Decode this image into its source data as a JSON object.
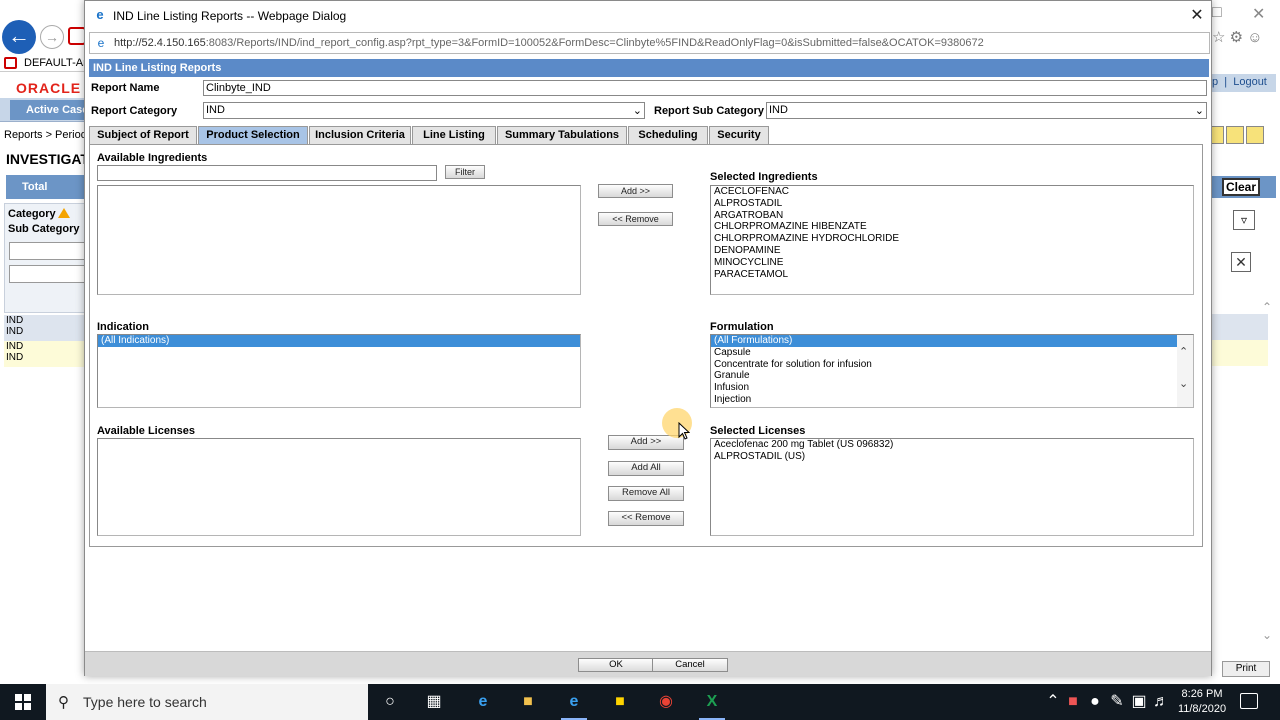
{
  "browser": {
    "tab_title": "DEFAULT-Ar",
    "oracle_logo": "ORACLE",
    "active_case_tab": "Active Case",
    "breadcrumb": "Reports > Period",
    "page_heading": "INVESTIGAT",
    "total_label": "Total Numbe",
    "category_label": "Category",
    "subcategory_label": "Sub Category",
    "rows": [
      "IND",
      "IND",
      "IND",
      "IND"
    ],
    "help_link": "p",
    "logout_link": "Logout",
    "clear_button": "Clear",
    "print_button": "Print"
  },
  "dialog": {
    "title": "IND Line Listing Reports -- Webpage Dialog",
    "url_host": "http://52.4.150.165",
    "url_rest": ":8083/Reports/IND/ind_report_config.asp?rpt_type=3&FormID=100052&FormDesc=Clinbyte%5FIND&ReadOnlyFlag=0&isSubmitted=false&OCATOK=9380672",
    "header": "IND Line Listing Reports",
    "report_name_label": "Report Name",
    "report_name_value": "Clinbyte_IND",
    "report_category_label": "Report Category",
    "report_category_value": "IND",
    "report_subcategory_label": "Report Sub Category",
    "report_subcategory_value": "IND",
    "tabs": [
      "Subject of Report",
      "Product Selection",
      "Inclusion Criteria",
      "Line Listing",
      "Summary Tabulations",
      "Scheduling",
      "Security"
    ],
    "active_tab": "Product Selection",
    "available_ingredients_label": "Available Ingredients",
    "filter_button": "Filter",
    "ingredients_add_button": "Add >>",
    "ingredients_remove_button": "<< Remove",
    "selected_ingredients_label": "Selected Ingredients",
    "selected_ingredients": [
      "ACECLOFENAC",
      "ALPROSTADIL",
      "ARGATROBAN",
      "CHLORPROMAZINE HIBENZATE",
      "CHLORPROMAZINE HYDROCHLORIDE",
      "DENOPAMINE",
      "MINOCYCLINE",
      "PARACETAMOL"
    ],
    "indication_label": "Indication",
    "indications": [
      "(All Indications)"
    ],
    "formulation_label": "Formulation",
    "formulations": [
      "(All Formulations)",
      "Capsule",
      "Concentrate for solution for infusion",
      "Granule",
      "Infusion",
      "Injection"
    ],
    "available_licenses_label": "Available Licenses",
    "licenses_add_button": "Add >>",
    "licenses_add_all_button": "Add All",
    "licenses_remove_all_button": "Remove All",
    "licenses_remove_button": "<< Remove",
    "selected_licenses_label": "Selected Licenses",
    "selected_licenses": [
      "Aceclofenac 200 mg Tablet (US 096832)",
      "ALPROSTADIL (US)"
    ],
    "ok_button": "OK",
    "cancel_button": "Cancel"
  },
  "taskbar": {
    "search_placeholder": "Type here to search",
    "time": "8:26 PM",
    "date": "11/8/2020"
  },
  "colors": {
    "header_blue": "#5b8ac8",
    "active_tab": "#a8c4e6",
    "selection": "#3d8ed8",
    "oracle_red": "#e2231a",
    "taskbar": "#101820"
  }
}
